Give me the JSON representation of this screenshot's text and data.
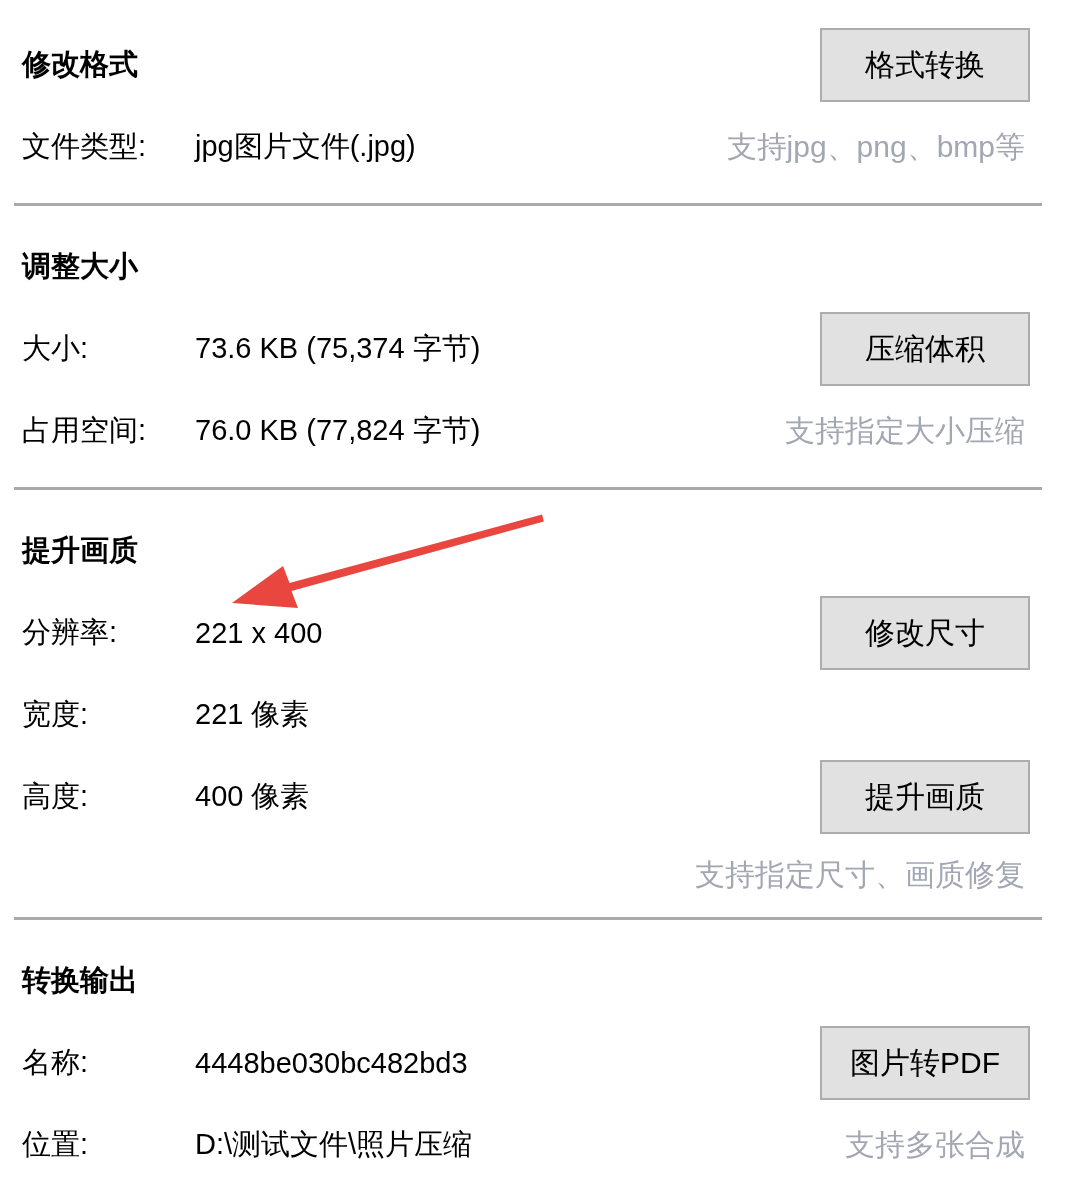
{
  "sections": [
    {
      "lines": [
        {
          "kind": "heading",
          "text": "修改格式",
          "button": "格式转换"
        },
        {
          "kind": "field",
          "label": "文件类型:",
          "value": "jpg图片文件(.jpg)",
          "hint": "支持jpg、png、bmp等"
        }
      ]
    },
    {
      "lines": [
        {
          "kind": "heading",
          "text": "调整大小"
        },
        {
          "kind": "field",
          "label": "大小:",
          "value": "73.6 KB (75,374 字节)",
          "button": "压缩体积"
        },
        {
          "kind": "field",
          "label": "占用空间:",
          "value": "76.0 KB (77,824 字节)",
          "hint": "支持指定大小压缩"
        }
      ]
    },
    {
      "lines": [
        {
          "kind": "heading",
          "text": "提升画质"
        },
        {
          "kind": "field",
          "label": "分辨率:",
          "value": "221 x 400",
          "button": "修改尺寸"
        },
        {
          "kind": "field",
          "label": "宽度:",
          "value": "221 像素"
        },
        {
          "kind": "field",
          "label": "高度:",
          "value": "400 像素",
          "button": "提升画质"
        },
        {
          "kind": "note",
          "hint": "支持指定尺寸、画质修复"
        }
      ]
    },
    {
      "lines": [
        {
          "kind": "heading",
          "text": "转换输出"
        },
        {
          "kind": "field",
          "label": "名称:",
          "value": "4448be030bc482bd3",
          "button": "图片转PDF"
        },
        {
          "kind": "field",
          "label": "位置:",
          "value": "D:\\测试文件\\照片压缩",
          "hint": "支持多张合成"
        }
      ]
    }
  ],
  "annotations": [
    {
      "kind": "arrow"
    }
  ]
}
